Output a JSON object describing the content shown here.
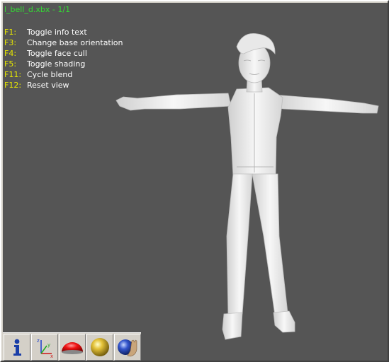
{
  "window": {
    "title": "l_bell_d.xbx - 1/1"
  },
  "colors": {
    "viewport_bg": "#555555",
    "title_color": "#33dd33",
    "key_color": "#e8e800",
    "text_color": "#ffffff",
    "model_color": "#f2f2f2"
  },
  "help": {
    "items": [
      {
        "key": "F1:",
        "label": "Toggle info text"
      },
      {
        "key": "F3:",
        "label": "Change base orientation"
      },
      {
        "key": "F4:",
        "label": "Toggle face cull"
      },
      {
        "key": "F5:",
        "label": "Toggle shading"
      },
      {
        "key": "F11:",
        "label": "Cycle blend"
      },
      {
        "key": "F12:",
        "label": "Reset view"
      }
    ]
  },
  "toolbar": {
    "buttons": [
      {
        "icon": "info-icon"
      },
      {
        "icon": "axes-icon"
      },
      {
        "icon": "red-dome-icon"
      },
      {
        "icon": "yellow-sphere-icon"
      },
      {
        "icon": "hand-sphere-icon"
      }
    ],
    "axes_labels": {
      "z": "z",
      "y": "y",
      "x": "x"
    }
  }
}
